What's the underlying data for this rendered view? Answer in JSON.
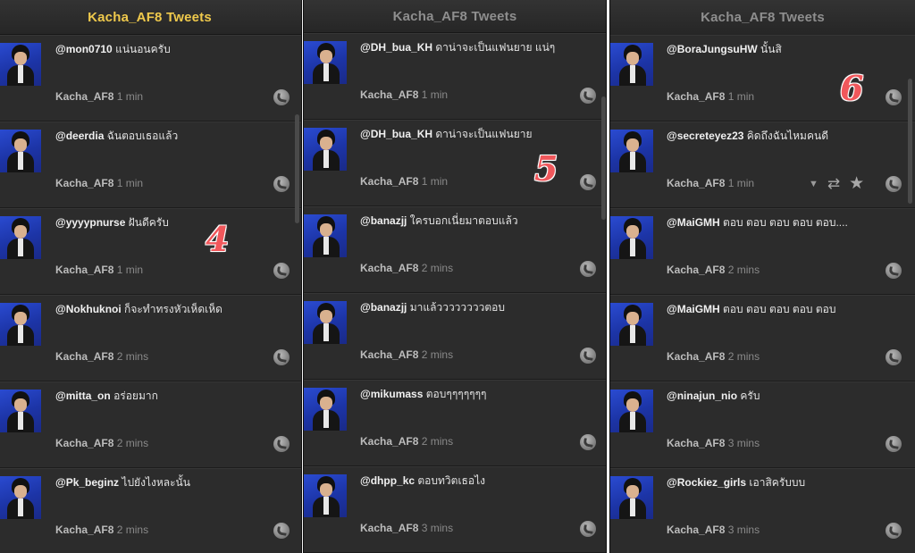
{
  "columns": [
    {
      "header": "Kacha_AF8 Tweets",
      "active": true,
      "tweets": [
        {
          "handle": "@mon0710",
          "text": "แน่นอนครับ",
          "user": "Kacha_AF8",
          "time": "1 min"
        },
        {
          "handle": "@deerdia",
          "text": "ฉันตอบเธอแล้ว",
          "user": "Kacha_AF8",
          "time": "1 min"
        },
        {
          "handle": "@yyyypnurse",
          "text": "ฝันดีครับ",
          "user": "Kacha_AF8",
          "time": "1 min"
        },
        {
          "handle": "@Nokhuknoi",
          "text": "ก็จะทำทรงหัวเห็ดเห็ด",
          "user": "Kacha_AF8",
          "time": "2 mins"
        },
        {
          "handle": "@mitta_on",
          "text": "อร่อยมาก",
          "user": "Kacha_AF8",
          "time": "2 mins"
        },
        {
          "handle": "@Pk_beginz",
          "text": "ไปยังไงหละนั้น",
          "user": "Kacha_AF8",
          "time": "2 mins"
        }
      ]
    },
    {
      "header": "Kacha_AF8 Tweets",
      "active": false,
      "tweets": [
        {
          "handle": "@DH_bua_KH",
          "text": "ดาน่าจะเป็นแฟนยาย แน่ๆ",
          "user": "Kacha_AF8",
          "time": "1 min"
        },
        {
          "handle": "@DH_bua_KH",
          "text": "ดาน่าจะเป็นแฟนยาย",
          "user": "Kacha_AF8",
          "time": "1 min"
        },
        {
          "handle": "@banazjj",
          "text": "ใครบอกเนี่ยมาตอบแล้ว",
          "user": "Kacha_AF8",
          "time": "2 mins"
        },
        {
          "handle": "@banazjj",
          "text": "มาแล้ววววววววตอบ",
          "user": "Kacha_AF8",
          "time": "2 mins"
        },
        {
          "handle": "@mikumass",
          "text": "ตอบๆๆๆๆๆๆๆ",
          "user": "Kacha_AF8",
          "time": "2 mins"
        },
        {
          "handle": "@dhpp_kc",
          "text": "ตอบทวิตเธอไง",
          "user": "Kacha_AF8",
          "time": "3 mins"
        }
      ]
    },
    {
      "header": "Kacha_AF8 Tweets",
      "active": false,
      "tweets": [
        {
          "handle": "@BoraJungsuHW",
          "text": "นั้นสิ",
          "user": "Kacha_AF8",
          "time": "1 min"
        },
        {
          "handle": "@secreteyez23",
          "text": "คิดถึงฉันไหมคนดี",
          "user": "Kacha_AF8",
          "time": "1 min",
          "hover_actions": true
        },
        {
          "handle": "@MaiGMH",
          "text": "ตอบ ตอบ ตอบ ตอบ ตอบ....",
          "user": "Kacha_AF8",
          "time": "2 mins"
        },
        {
          "handle": "@MaiGMH",
          "text": "ตอบ ตอบ ตอบ ตอบ ตอบ",
          "user": "Kacha_AF8",
          "time": "2 mins"
        },
        {
          "handle": "@ninajun_nio",
          "text": "ครับ",
          "user": "Kacha_AF8",
          "time": "3 mins"
        },
        {
          "handle": "@Rockiez_girls",
          "text": "เอาสิครับบบ",
          "user": "Kacha_AF8",
          "time": "3 mins"
        }
      ]
    }
  ],
  "markers": [
    "4",
    "5",
    "6"
  ],
  "icons": {
    "reply": "reply-icon",
    "dropdown": "chevron-down-icon",
    "retweet": "retweet-icon",
    "favorite": "star-icon"
  },
  "colors": {
    "active_header": "#efc94c",
    "inactive_header": "#8e8e8e",
    "column_bg": "#2b2b2b",
    "marker": "#f0575b"
  }
}
